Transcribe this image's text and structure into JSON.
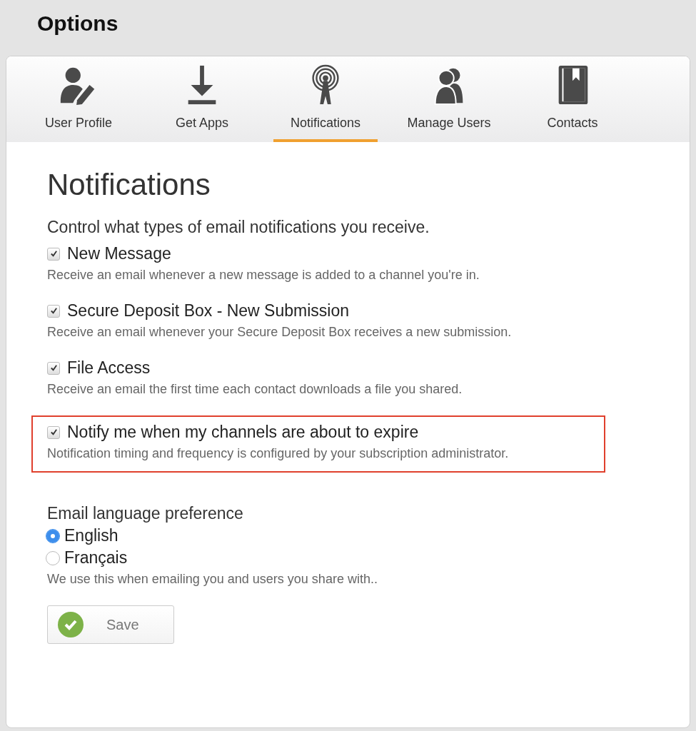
{
  "page_title": "Options",
  "tabs": [
    {
      "label": "User Profile",
      "selected": false
    },
    {
      "label": "Get Apps",
      "selected": false
    },
    {
      "label": "Notifications",
      "selected": true
    },
    {
      "label": "Manage Users",
      "selected": false
    },
    {
      "label": "Contacts",
      "selected": false
    }
  ],
  "heading": "Notifications",
  "intro": "Control what types of email notifications you receive.",
  "options": [
    {
      "label": "New Message",
      "description": "Receive an email whenever a new message is added to a channel you're in.",
      "checked": true,
      "highlighted": false
    },
    {
      "label": "Secure Deposit Box - New Submission",
      "description": "Receive an email whenever your Secure Deposit Box receives a new submission.",
      "checked": true,
      "highlighted": false
    },
    {
      "label": "File Access",
      "description": "Receive an email the first time each contact downloads a file you shared.",
      "checked": true,
      "highlighted": false
    },
    {
      "label": "Notify me when my channels are about to expire",
      "description": "Notification timing and frequency is configured by your subscription administrator.",
      "checked": true,
      "highlighted": true
    }
  ],
  "language": {
    "title": "Email language preference",
    "choices": [
      {
        "label": "English",
        "selected": true
      },
      {
        "label": "Français",
        "selected": false
      }
    ],
    "note": "We use this when emailing you and users you share with.."
  },
  "save_button": "Save"
}
